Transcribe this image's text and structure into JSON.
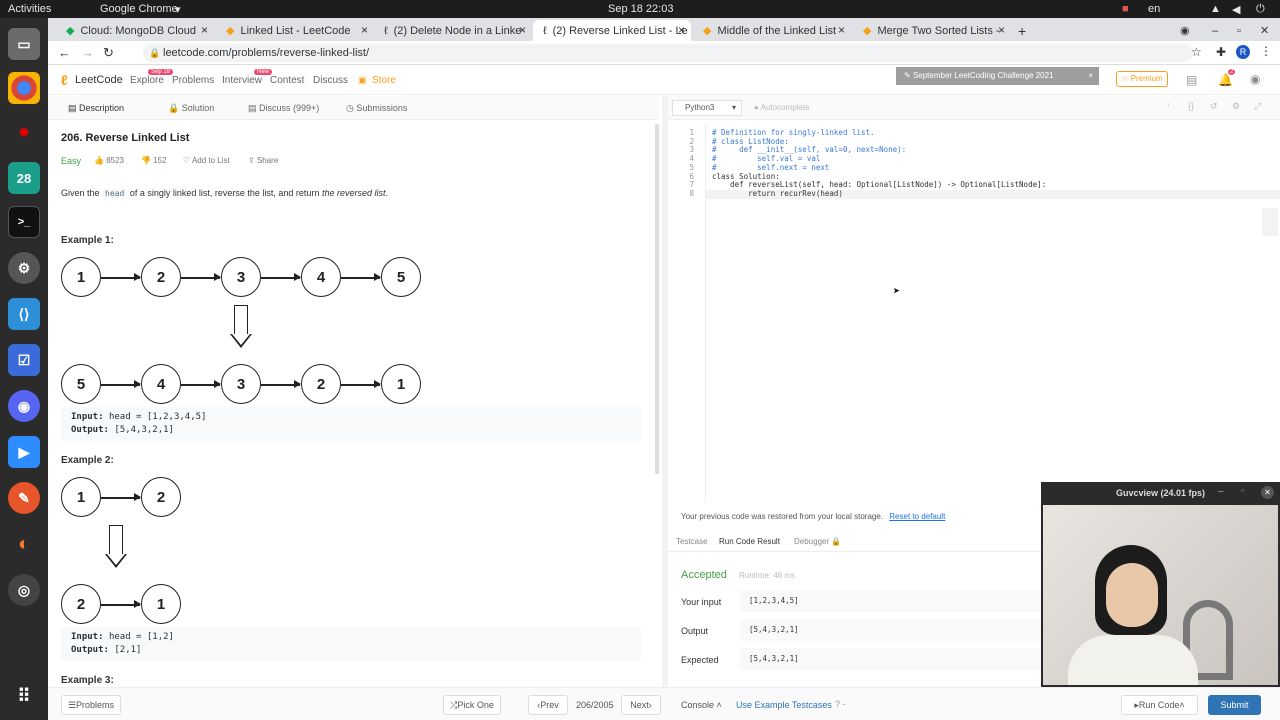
{
  "topbar": {
    "activities": "Activities",
    "app": "Google Chrome",
    "clock": "Sep 18  22:03",
    "lang": "en"
  },
  "tabs": [
    {
      "label": "Cloud: MongoDB Cloud"
    },
    {
      "label": "Linked List - LeetCode"
    },
    {
      "label": "(2) Delete Node in a Linke"
    },
    {
      "label": "(2) Reverse Linked List - Le"
    },
    {
      "label": "Middle of the Linked List"
    },
    {
      "label": "Merge Two Sorted Lists -"
    }
  ],
  "address": {
    "url": "leetcode.com/problems/reverse-linked-list/"
  },
  "nav": {
    "brand": "LeetCode",
    "explore": "Explore",
    "explore_badge": "Sep 18",
    "problems": "Problems",
    "interview": "Interview",
    "interview_badge": "New",
    "contest": "Contest",
    "discuss": "Discuss",
    "store": "Store",
    "challenge": "September LeetCoding Challenge 2021",
    "premium": "Premium",
    "notif_count": "2"
  },
  "subtabs": {
    "description": "Description",
    "solution": "Solution",
    "discuss": "Discuss (999+)",
    "submissions": "Submissions"
  },
  "problem": {
    "title": "206. Reverse Linked List",
    "difficulty": "Easy",
    "likes": "8523",
    "dislikes": "152",
    "add_to_list": "Add to List",
    "share": "Share",
    "stmt_pre": "Given the",
    "stmt_code": "head",
    "stmt_mid": "of a singly linked list, reverse the list, and return",
    "stmt_em": "the reversed list",
    "ex1_title": "Example 1:",
    "ex1_in_label": "Input:",
    "ex1_in": "head = [1,2,3,4,5]",
    "ex1_out_label": "Output:",
    "ex1_out": "[5,4,3,2,1]",
    "ex2_title": "Example 2:",
    "ex2_in_label": "Input:",
    "ex2_in": "head = [1,2]",
    "ex2_out_label": "Output:",
    "ex2_out": "[2,1]",
    "ex3_title": "Example 3:",
    "ex1_top": [
      "1",
      "2",
      "3",
      "4",
      "5"
    ],
    "ex1_bot": [
      "5",
      "4",
      "3",
      "2",
      "1"
    ],
    "ex2_top": [
      "1",
      "2"
    ],
    "ex2_bot": [
      "2",
      "1"
    ]
  },
  "editor": {
    "language": "Python3",
    "autocomplete": "Autocomplete",
    "lines": [
      {
        "n": "1",
        "t": "# Definition for singly-linked list."
      },
      {
        "n": "2",
        "t": "# class ListNode:"
      },
      {
        "n": "3",
        "t": "#     def __init__(self, val=0, next=None):"
      },
      {
        "n": "4",
        "t": "#         self.val = val"
      },
      {
        "n": "5",
        "t": "#         self.next = next"
      },
      {
        "n": "6",
        "t": "class Solution:"
      },
      {
        "n": "7",
        "t": "    def reverseList(self, head: Optional[ListNode]) -> Optional[ListNode]:"
      },
      {
        "n": "8",
        "t": "        return recurRev(head)"
      }
    ]
  },
  "results": {
    "restored": "Your previous code was restored from your local storage.",
    "reset": "Reset to default",
    "tab_testcase": "Testcase",
    "tab_run": "Run Code Result",
    "tab_debugger": "Debugger",
    "status": "Accepted",
    "runtime": "Runtime: 46 ms",
    "input_label": "Your input",
    "input": "[1,2,3,4,5]",
    "output_label": "Output",
    "output": "[5,4,3,2,1]",
    "expected_label": "Expected",
    "expected": "[5,4,3,2,1]"
  },
  "bottom": {
    "problems": "Problems",
    "pick": "Pick One",
    "prev": "Prev",
    "page": "206/2005",
    "next": "Next",
    "console": "Console",
    "use_example": "Use Example Testcases",
    "run": "Run Code",
    "submit": "Submit"
  },
  "video": {
    "title": "Guvcview  (24.01 fps)"
  },
  "colors": {
    "accent_orange": "#f89f1b",
    "easy_green": "#43a047",
    "accepted_green": "#43a047",
    "submit_blue": "#2f75b5",
    "link_blue": "#1a73e8"
  }
}
